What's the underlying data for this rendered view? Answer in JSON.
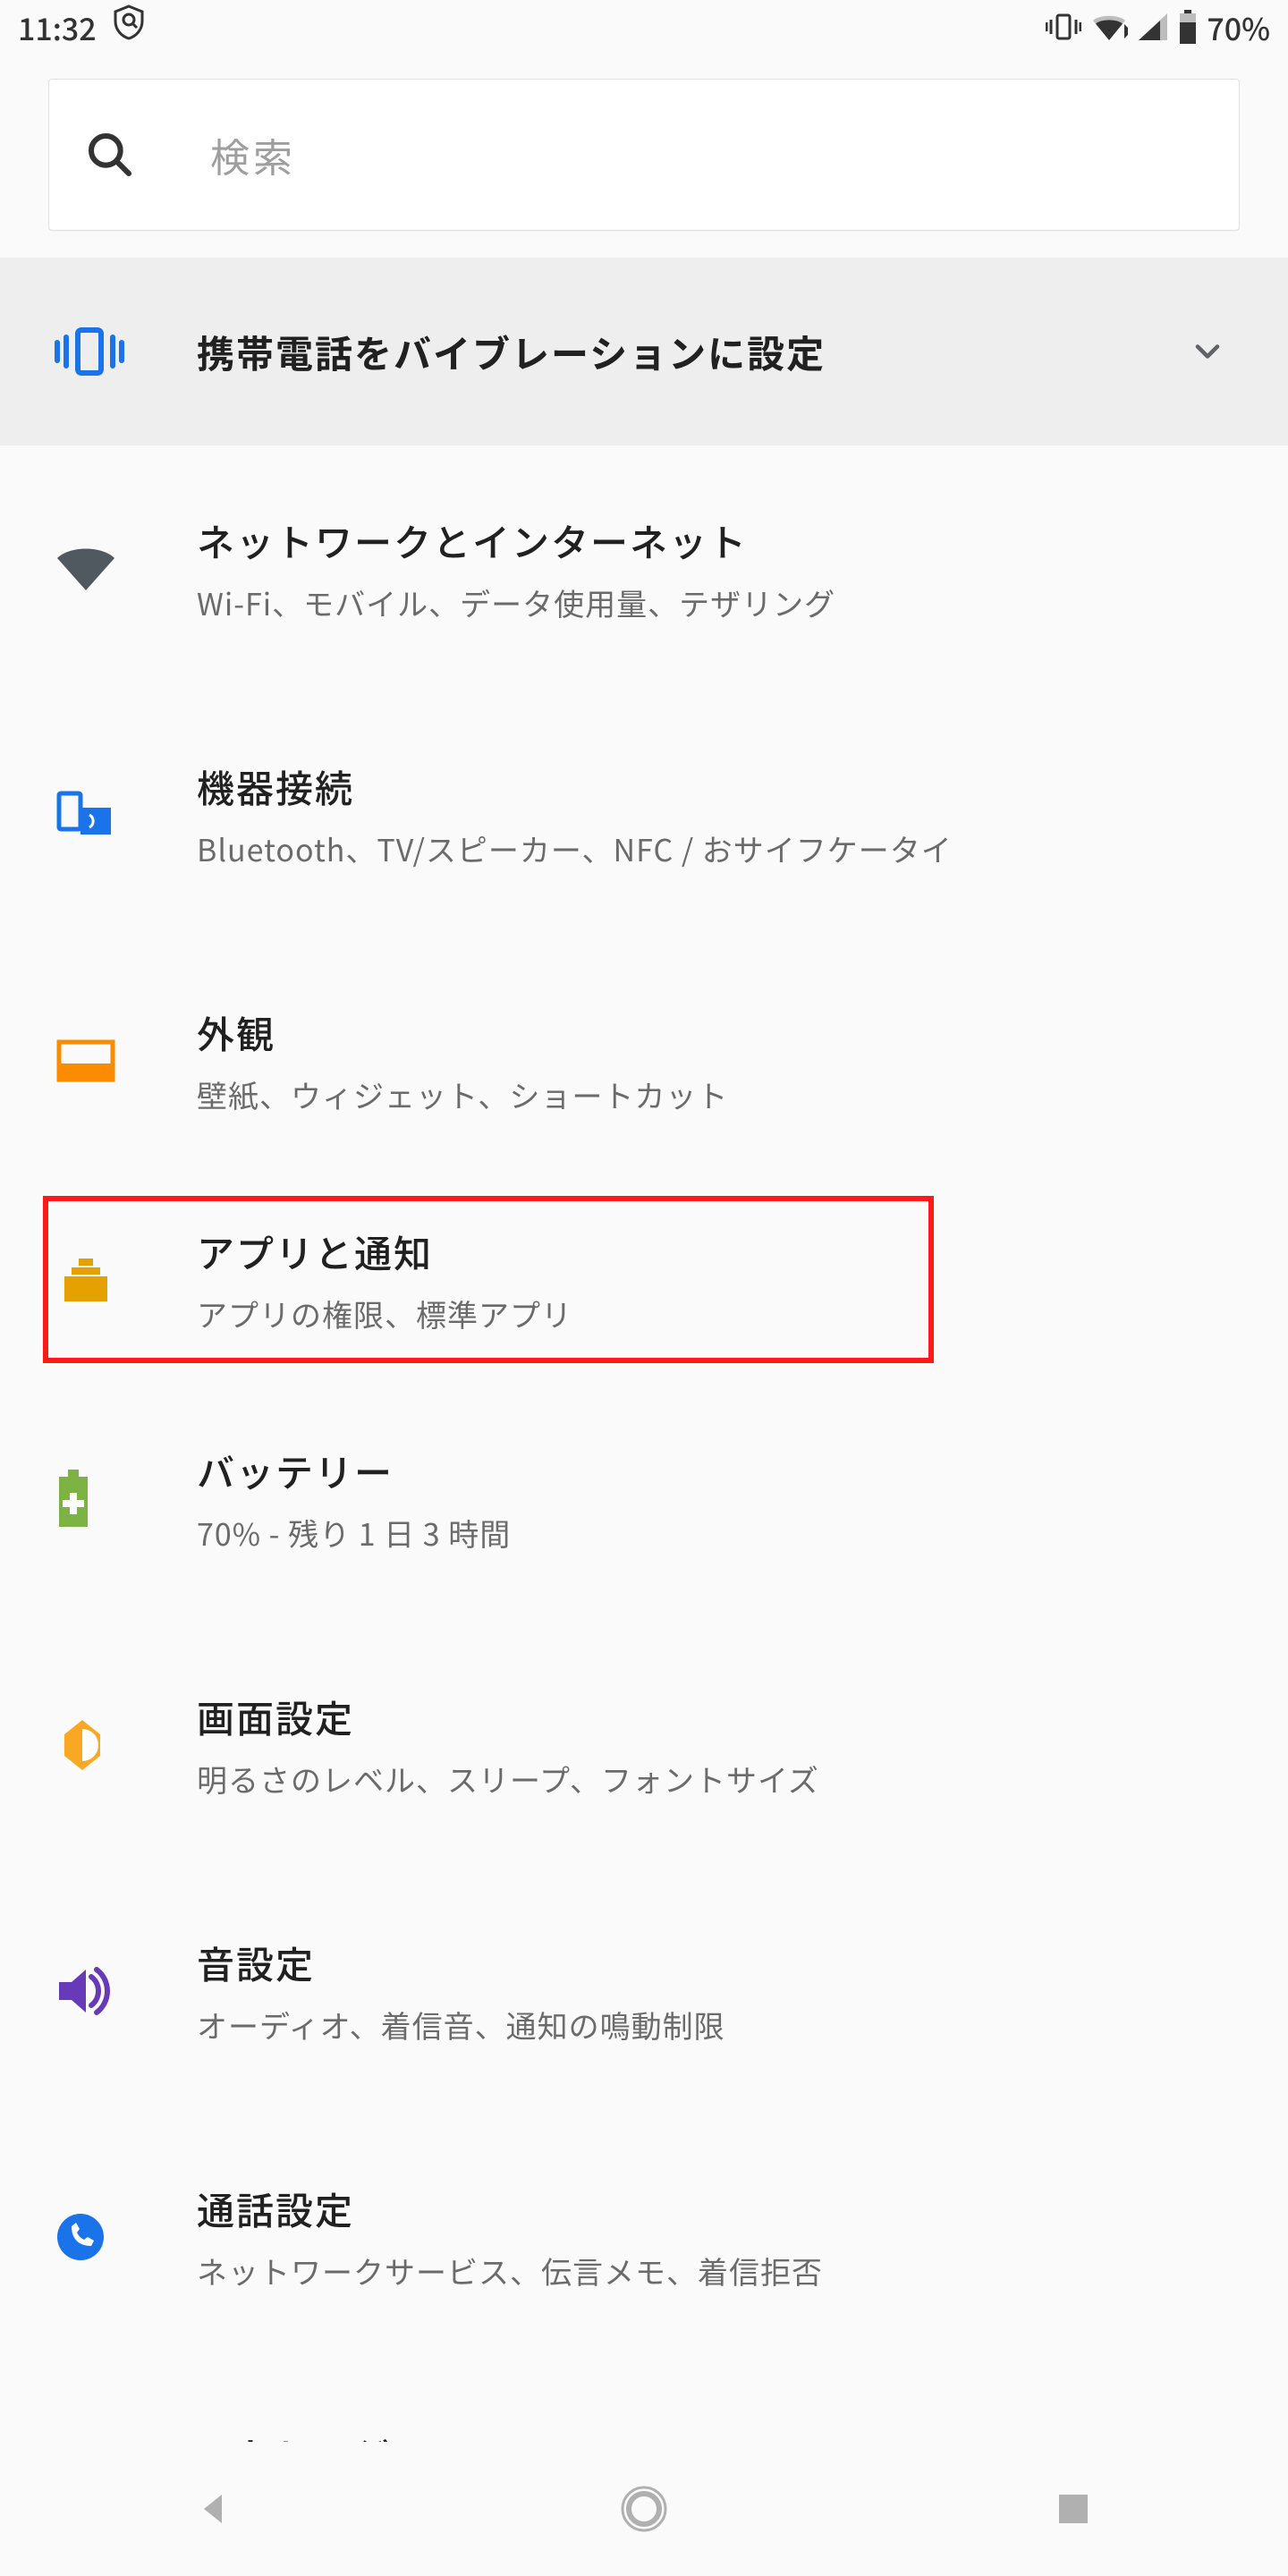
{
  "status": {
    "time": "11:32",
    "battery_pct": "70%"
  },
  "search": {
    "placeholder": "検索"
  },
  "banner": {
    "label": "携帯電話をバイブレーションに設定"
  },
  "rows": {
    "network": {
      "title": "ネットワークとインターネット",
      "sub": "Wi-Fi、モバイル、データ使用量、テザリング"
    },
    "devices": {
      "title": "機器接続",
      "sub": "Bluetooth、TV/スピーカー、NFC / おサイフケータイ"
    },
    "appearance": {
      "title": "外観",
      "sub": "壁紙、ウィジェット、ショートカット"
    },
    "apps": {
      "title": "アプリと通知",
      "sub": "アプリの権限、標準アプリ"
    },
    "battery": {
      "title": "バッテリー",
      "sub": "70% - 残り 1 日 3 時間"
    },
    "display": {
      "title": "画面設定",
      "sub": "明るさのレベル、スリープ、フォントサイズ"
    },
    "sound": {
      "title": "音設定",
      "sub": "オーディオ、着信音、通知の鳴動制限"
    },
    "call": {
      "title": "通話設定",
      "sub": "ネットワークサービス、伝言メモ、着信拒否"
    },
    "storage": {
      "title": "ストレージ",
      "sub": ""
    }
  },
  "colors": {
    "accent_blue": "#1a73e8",
    "orange": "#fb8c00",
    "green": "#7cb342",
    "yellow": "#f9a825",
    "purple": "#673ab7",
    "gray_icon": "#5f6368"
  }
}
